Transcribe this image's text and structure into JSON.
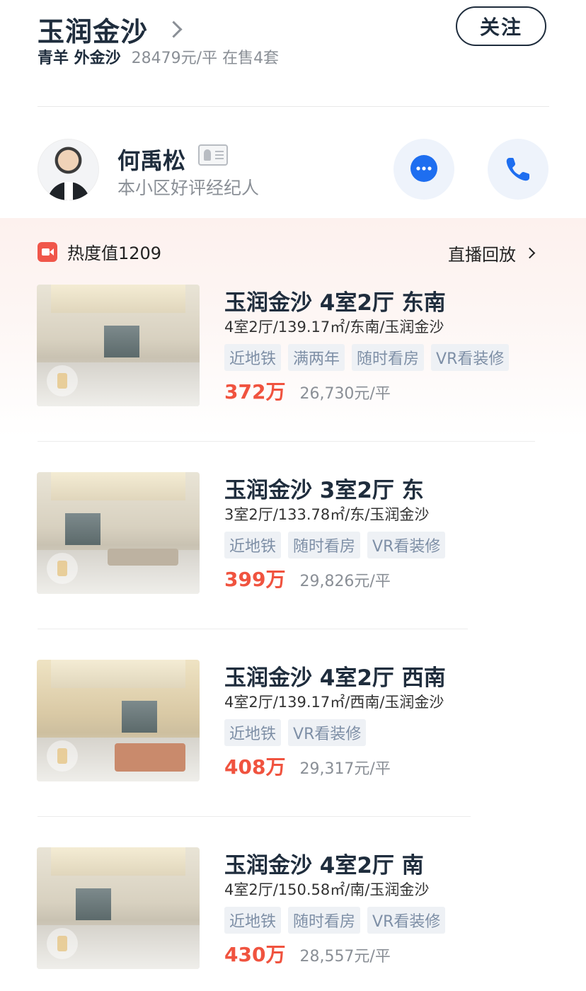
{
  "community": {
    "name": "玉润金沙",
    "area": "青羊 外金沙",
    "stats": "28479元/平 在售4套",
    "follow_label": "关注"
  },
  "agent": {
    "name": "何禹松",
    "role": "本小区好评经纪人"
  },
  "heat": {
    "label": "热度值1209",
    "replay_label": "直播回放"
  },
  "listings": [
    {
      "title": "玉润金沙 4室2厅 东南",
      "spec": "4室2厅/139.17㎡/东南/玉润金沙",
      "tags": [
        "近地铁",
        "满两年",
        "随时看房",
        "VR看装修"
      ],
      "price": "372万",
      "unit_price": "26,730元/平"
    },
    {
      "title": "玉润金沙 3室2厅 东",
      "spec": "3室2厅/133.78㎡/东/玉润金沙",
      "tags": [
        "近地铁",
        "随时看房",
        "VR看装修"
      ],
      "price": "399万",
      "unit_price": "29,826元/平"
    },
    {
      "title": "玉润金沙 4室2厅 西南",
      "spec": "4室2厅/139.17㎡/西南/玉润金沙",
      "tags": [
        "近地铁",
        "VR看装修"
      ],
      "price": "408万",
      "unit_price": "29,317元/平"
    },
    {
      "title": "玉润金沙 4室2厅 南",
      "spec": "4室2厅/150.58㎡/南/玉润金沙",
      "tags": [
        "近地铁",
        "随时看房",
        "VR看装修"
      ],
      "price": "430万",
      "unit_price": "28,557元/平"
    }
  ],
  "colors": {
    "accent_price": "#f0533f",
    "primary_text": "#1f2d3d",
    "tag_bg": "#eef1f5",
    "tag_text": "#7e8fa6",
    "call_icon": "#1e6ef0"
  }
}
